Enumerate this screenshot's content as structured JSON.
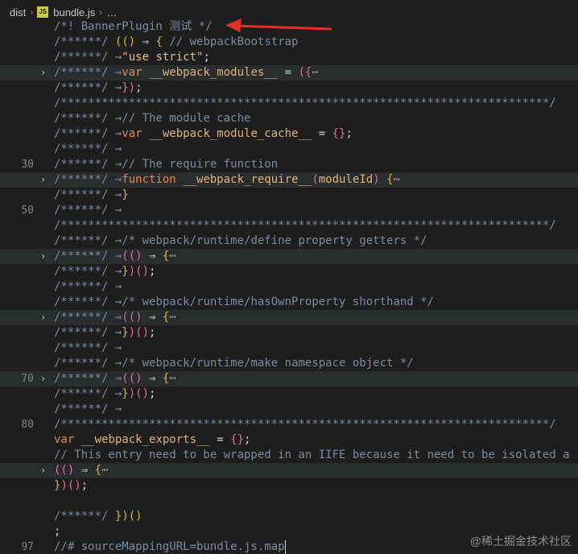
{
  "breadcrumb": {
    "folder": "dist",
    "file": "bundle.js",
    "ellipsis": "…",
    "file_badge": "JS"
  },
  "lines": [
    {
      "num": "",
      "fold": false,
      "folded": false,
      "tokens": [
        [
          "c-com",
          "/*! BannerPlugin 测试 */"
        ]
      ]
    },
    {
      "num": "",
      "fold": false,
      "folded": false,
      "tokens": [
        [
          "c-com",
          "/******/ "
        ],
        [
          "c-par",
          "(()"
        ],
        [
          "c-pun",
          " ⇒ "
        ],
        [
          "c-brace",
          "{"
        ],
        [
          "c-com",
          " // webpackBootstrap"
        ]
      ]
    },
    {
      "num": "",
      "fold": false,
      "folded": false,
      "tokens": [
        [
          "c-com",
          "/******/ "
        ],
        [
          "c-com",
          "→"
        ],
        [
          "c-str",
          "\"use strict\""
        ],
        [
          "c-pun",
          ";"
        ]
      ]
    },
    {
      "num": "",
      "fold": true,
      "folded": true,
      "tokens": [
        [
          "c-com",
          "/******/ "
        ],
        [
          "c-com",
          "→"
        ],
        [
          "c-kw",
          "var"
        ],
        [
          "c-ident",
          " __webpack_modules__"
        ],
        [
          "c-pun",
          " = "
        ],
        [
          "c-pink",
          "({"
        ],
        [
          "c-ell",
          "⋯"
        ]
      ]
    },
    {
      "num": "",
      "fold": false,
      "folded": false,
      "tokens": [
        [
          "c-com",
          "/******/ "
        ],
        [
          "c-com",
          "→"
        ],
        [
          "c-pink",
          "})"
        ],
        [
          "c-pun",
          ";"
        ]
      ]
    },
    {
      "num": "",
      "fold": false,
      "folded": false,
      "tokens": [
        [
          "c-com",
          "/************************************************************************/"
        ]
      ]
    },
    {
      "num": "",
      "fold": false,
      "folded": false,
      "tokens": [
        [
          "c-com",
          "/******/ "
        ],
        [
          "c-com",
          "→"
        ],
        [
          "c-com",
          "// The module cache"
        ]
      ]
    },
    {
      "num": "",
      "fold": false,
      "folded": false,
      "tokens": [
        [
          "c-com",
          "/******/ "
        ],
        [
          "c-com",
          "→"
        ],
        [
          "c-kw",
          "var"
        ],
        [
          "c-ident",
          " __webpack_module_cache__"
        ],
        [
          "c-pun",
          " = "
        ],
        [
          "c-pink",
          "{}"
        ],
        [
          "c-pun",
          ";"
        ]
      ]
    },
    {
      "num": "",
      "fold": false,
      "folded": false,
      "tokens": [
        [
          "c-com",
          "/******/ "
        ],
        [
          "c-com",
          "→"
        ]
      ]
    },
    {
      "num": "30",
      "fold": false,
      "folded": false,
      "tokens": [
        [
          "c-com",
          "/******/ "
        ],
        [
          "c-com",
          "→"
        ],
        [
          "c-com",
          "// The require function"
        ]
      ]
    },
    {
      "num": "",
      "fold": true,
      "folded": true,
      "tokens": [
        [
          "c-com",
          "/******/ "
        ],
        [
          "c-com",
          "→"
        ],
        [
          "c-kw",
          "function"
        ],
        [
          "c-fn",
          " __webpack_require__"
        ],
        [
          "c-pink",
          "("
        ],
        [
          "c-ident",
          "moduleId"
        ],
        [
          "c-pink",
          ")"
        ],
        [
          "c-pun",
          " "
        ],
        [
          "c-brace",
          "{"
        ],
        [
          "c-ell",
          "⋯"
        ]
      ]
    },
    {
      "num": "",
      "fold": false,
      "folded": false,
      "tokens": [
        [
          "c-com",
          "/******/ "
        ],
        [
          "c-com",
          "→"
        ],
        [
          "c-brace",
          "}"
        ]
      ]
    },
    {
      "num": "50",
      "fold": false,
      "folded": false,
      "tokens": [
        [
          "c-com",
          "/******/ "
        ],
        [
          "c-com",
          "→"
        ]
      ]
    },
    {
      "num": "",
      "fold": false,
      "folded": false,
      "tokens": [
        [
          "c-com",
          "/************************************************************************/"
        ]
      ]
    },
    {
      "num": "",
      "fold": false,
      "folded": false,
      "tokens": [
        [
          "c-com",
          "/******/ "
        ],
        [
          "c-com",
          "→"
        ],
        [
          "c-com",
          "/* webpack/runtime/define property getters */"
        ]
      ]
    },
    {
      "num": "",
      "fold": true,
      "folded": true,
      "tokens": [
        [
          "c-com",
          "/******/ "
        ],
        [
          "c-com",
          "→"
        ],
        [
          "c-pink",
          "(()"
        ],
        [
          "c-pun",
          " ⇒ "
        ],
        [
          "c-brace",
          "{"
        ],
        [
          "c-ell",
          "⋯"
        ]
      ]
    },
    {
      "num": "",
      "fold": false,
      "folded": false,
      "tokens": [
        [
          "c-com",
          "/******/ "
        ],
        [
          "c-com",
          "→"
        ],
        [
          "c-brace",
          "}"
        ],
        [
          "c-pink",
          ")()"
        ],
        [
          "c-pun",
          ";"
        ]
      ]
    },
    {
      "num": "",
      "fold": false,
      "folded": false,
      "tokens": [
        [
          "c-com",
          "/******/ "
        ],
        [
          "c-com",
          "→"
        ]
      ]
    },
    {
      "num": "",
      "fold": false,
      "folded": false,
      "tokens": [
        [
          "c-com",
          "/******/ "
        ],
        [
          "c-com",
          "→"
        ],
        [
          "c-com",
          "/* webpack/runtime/hasOwnProperty shorthand */"
        ]
      ]
    },
    {
      "num": "",
      "fold": true,
      "folded": true,
      "tokens": [
        [
          "c-com",
          "/******/ "
        ],
        [
          "c-com",
          "→"
        ],
        [
          "c-pink",
          "(()"
        ],
        [
          "c-pun",
          " ⇒ "
        ],
        [
          "c-brace",
          "{"
        ],
        [
          "c-ell",
          "⋯"
        ]
      ]
    },
    {
      "num": "",
      "fold": false,
      "folded": false,
      "tokens": [
        [
          "c-com",
          "/******/ "
        ],
        [
          "c-com",
          "→"
        ],
        [
          "c-brace",
          "}"
        ],
        [
          "c-pink",
          ")()"
        ],
        [
          "c-pun",
          ";"
        ]
      ]
    },
    {
      "num": "",
      "fold": false,
      "folded": false,
      "tokens": [
        [
          "c-com",
          "/******/ "
        ],
        [
          "c-com",
          "→"
        ]
      ]
    },
    {
      "num": "",
      "fold": false,
      "folded": false,
      "tokens": [
        [
          "c-com",
          "/******/ "
        ],
        [
          "c-com",
          "→"
        ],
        [
          "c-com",
          "/* webpack/runtime/make namespace object */"
        ]
      ]
    },
    {
      "num": "70",
      "fold": true,
      "folded": true,
      "tokens": [
        [
          "c-com",
          "/******/ "
        ],
        [
          "c-com",
          "→"
        ],
        [
          "c-pink",
          "(()"
        ],
        [
          "c-pun",
          " ⇒ "
        ],
        [
          "c-brace",
          "{"
        ],
        [
          "c-ell",
          "⋯"
        ]
      ]
    },
    {
      "num": "",
      "fold": false,
      "folded": false,
      "tokens": [
        [
          "c-com",
          "/******/ "
        ],
        [
          "c-com",
          "→"
        ],
        [
          "c-brace",
          "}"
        ],
        [
          "c-pink",
          ")()"
        ],
        [
          "c-pun",
          ";"
        ]
      ]
    },
    {
      "num": "",
      "fold": false,
      "folded": false,
      "tokens": [
        [
          "c-com",
          "/******/ "
        ],
        [
          "c-com",
          "→"
        ]
      ]
    },
    {
      "num": "80",
      "fold": false,
      "folded": false,
      "tokens": [
        [
          "c-com",
          "/************************************************************************/"
        ]
      ]
    },
    {
      "num": "",
      "fold": false,
      "folded": false,
      "tokens": [
        [
          "c-kw",
          "var"
        ],
        [
          "c-ident",
          " __webpack_exports__"
        ],
        [
          "c-pun",
          " = "
        ],
        [
          "c-pink",
          "{}"
        ],
        [
          "c-pun",
          ";"
        ]
      ]
    },
    {
      "num": "",
      "fold": false,
      "folded": false,
      "tokens": [
        [
          "c-com",
          "// This entry need to be wrapped in an IIFE because it need to be isolated a"
        ]
      ]
    },
    {
      "num": "",
      "fold": true,
      "folded": true,
      "tokens": [
        [
          "c-pink",
          "(()"
        ],
        [
          "c-pun",
          " ⇒ "
        ],
        [
          "c-brace",
          "{"
        ],
        [
          "c-ell",
          "⋯"
        ]
      ]
    },
    {
      "num": "",
      "fold": false,
      "folded": false,
      "tokens": [
        [
          "c-brace",
          "}"
        ],
        [
          "c-pink",
          ")()"
        ],
        [
          "c-pun",
          ";"
        ]
      ]
    },
    {
      "num": "",
      "fold": false,
      "folded": false,
      "tokens": []
    },
    {
      "num": "",
      "fold": false,
      "folded": false,
      "tokens": [
        [
          "c-com",
          "/******/ "
        ],
        [
          "c-par",
          "})()"
        ]
      ]
    },
    {
      "num": "",
      "fold": false,
      "folded": false,
      "tokens": [
        [
          "c-pun",
          ";"
        ]
      ]
    },
    {
      "num": "97",
      "fold": false,
      "folded": false,
      "tokens": [
        [
          "c-com",
          "//# sourceMappingURL=bundle.js.map"
        ]
      ],
      "cursor": true
    }
  ],
  "watermark": "@稀土掘金技术社区",
  "colors": {
    "background": "#1e1e1e",
    "annotation_arrow": "#e0302a"
  }
}
